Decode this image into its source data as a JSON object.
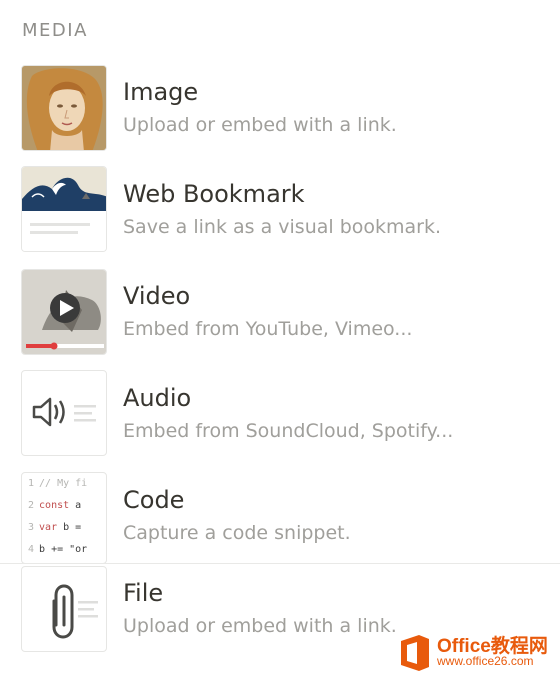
{
  "section": {
    "label": "MEDIA"
  },
  "items": [
    {
      "title": "Image",
      "description": "Upload or embed with a link."
    },
    {
      "title": "Web Bookmark",
      "description": "Save a link as a visual bookmark."
    },
    {
      "title": "Video",
      "description": "Embed from YouTube, Vimeo..."
    },
    {
      "title": "Audio",
      "description": "Embed from SoundCloud, Spotify..."
    },
    {
      "title": "Code",
      "description": "Capture a code snippet."
    },
    {
      "title": "File",
      "description": "Upload or embed with a link."
    }
  ],
  "code_thumb": {
    "lines": [
      {
        "num": "1",
        "kw": "",
        "text": "// My fi",
        "comment": true
      },
      {
        "num": "2",
        "kw": "const",
        "text": " a",
        "comment": false
      },
      {
        "num": "3",
        "kw": "var",
        "text": " b =",
        "comment": false
      },
      {
        "num": "4",
        "kw": "",
        "text": "b += \"or",
        "comment": false
      }
    ]
  },
  "icons": {
    "image": "venus-painting-thumbnail",
    "bookmark": "great-wave-bookmark-thumbnail",
    "video": "play-icon",
    "audio": "speaker-icon",
    "file": "paperclip-icon"
  },
  "watermark": {
    "brand": "Office教程网",
    "url": "www.office26.com"
  },
  "colors": {
    "title": "#37352f",
    "description": "#a09f9b",
    "section_label": "#8f8e8a",
    "accent_red": "#e03e3e",
    "watermark": "#e85a0c"
  }
}
